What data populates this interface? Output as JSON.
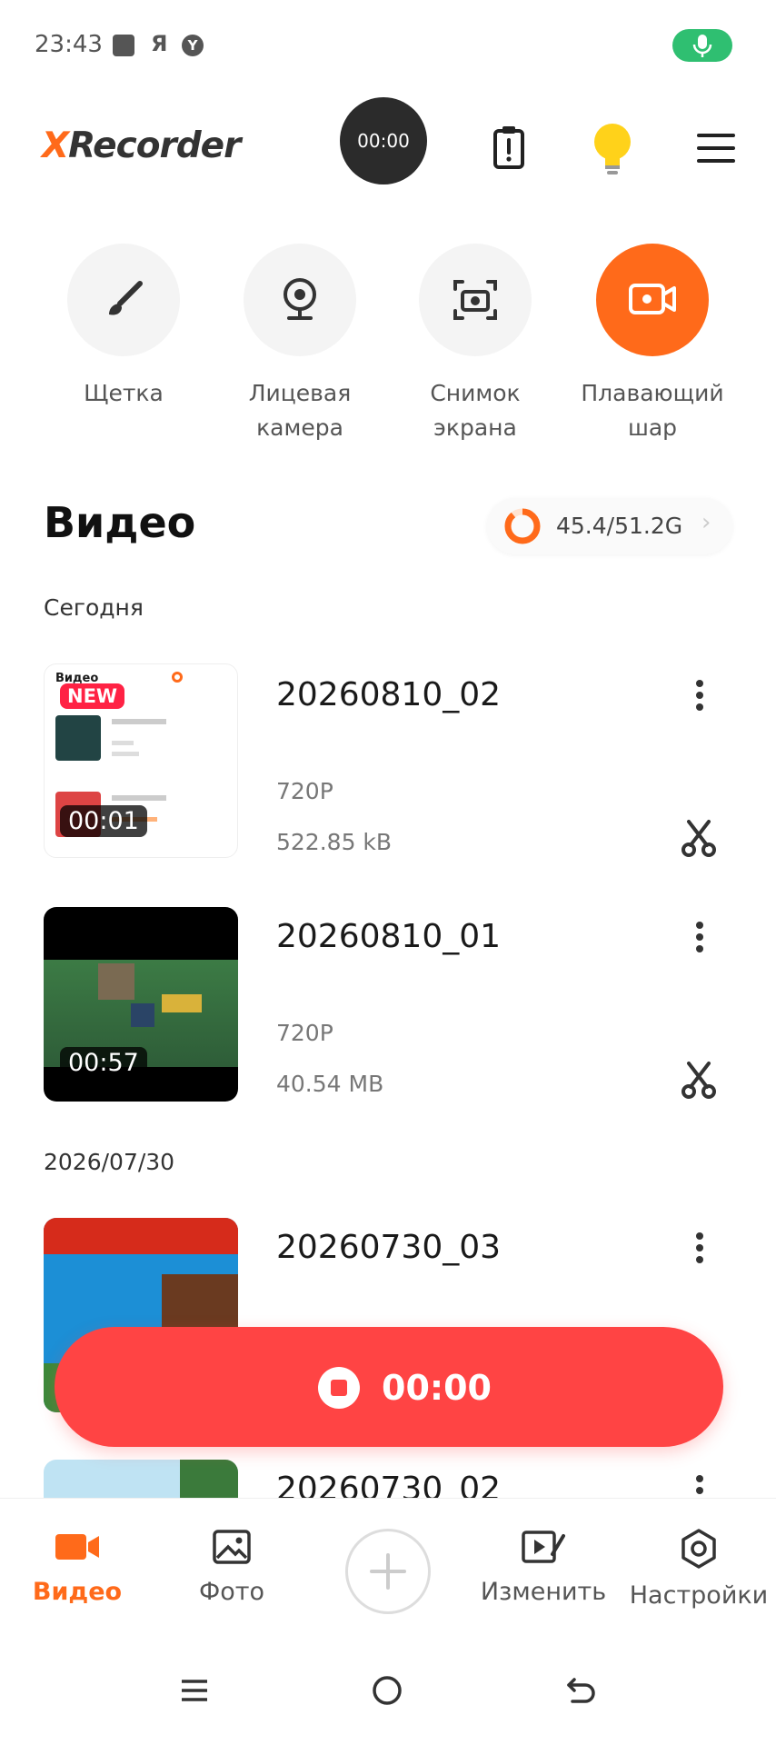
{
  "status_bar": {
    "time": "23:43",
    "ya": "Я"
  },
  "header": {
    "logo_x": "X",
    "logo_rest": "Recorder",
    "timer": "00:00"
  },
  "tools": [
    {
      "label": "Щетка",
      "icon": "brush-icon"
    },
    {
      "label": "Лицевая\nкамера",
      "icon": "webcam-icon"
    },
    {
      "label": "Снимок\nэкрана",
      "icon": "screenshot-icon"
    },
    {
      "label": "Плавающий\nшар",
      "icon": "floating-ball-icon"
    }
  ],
  "videos_section": {
    "title": "Видео",
    "storage": "45.4/51.2G",
    "storage_used_fraction": 0.89
  },
  "groups": [
    {
      "date": "Сегодня"
    },
    {
      "date": "2026/07/30"
    }
  ],
  "videos": [
    {
      "title": "20260810_02",
      "resolution": "720P",
      "size": "522.85 kB",
      "duration": "00:01",
      "badge": "NEW"
    },
    {
      "title": "20260810_01",
      "resolution": "720P",
      "size": "40.54 MB",
      "duration": "00:57"
    },
    {
      "title": "20260730_03"
    },
    {
      "title": "20260730_02"
    }
  ],
  "record_button": {
    "time": "00:00"
  },
  "bottom_nav": [
    {
      "label": "Видео",
      "icon": "video-camera-icon",
      "active": true
    },
    {
      "label": "Фото",
      "icon": "photo-icon"
    },
    {
      "label": "Изменить",
      "icon": "edit-video-icon"
    },
    {
      "label": "Настройки",
      "icon": "settings-icon"
    }
  ],
  "colors": {
    "accent": "#ff6a1a",
    "record": "#ff4444",
    "new_badge": "#ff2244",
    "mic": "#2fbf71"
  }
}
